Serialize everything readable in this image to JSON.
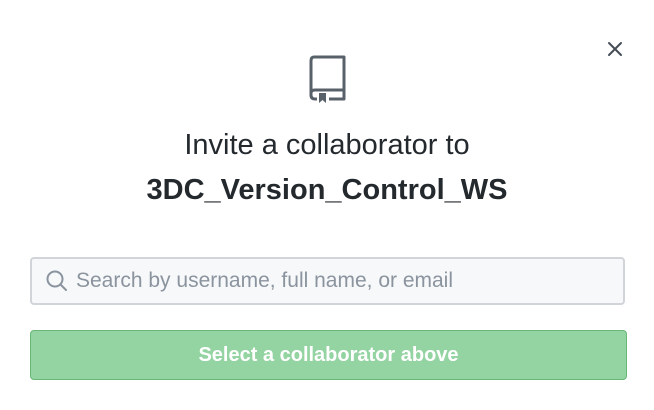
{
  "dialog": {
    "close_icon": "close-icon",
    "repo_icon": "repo-book-icon",
    "title_line1": "Invite a collaborator to",
    "repo_name": "3DC_Version_Control_WS"
  },
  "search": {
    "icon": "search-icon",
    "placeholder": "Search by username, full name, or email",
    "value": ""
  },
  "submit": {
    "label": "Select a collaborator above",
    "disabled": true
  },
  "colors": {
    "text": "#24292e",
    "button_bg": "#94d3a2",
    "button_border": "#67b776",
    "input_bg": "#f6f8fa",
    "input_border": "#d1d5da"
  }
}
